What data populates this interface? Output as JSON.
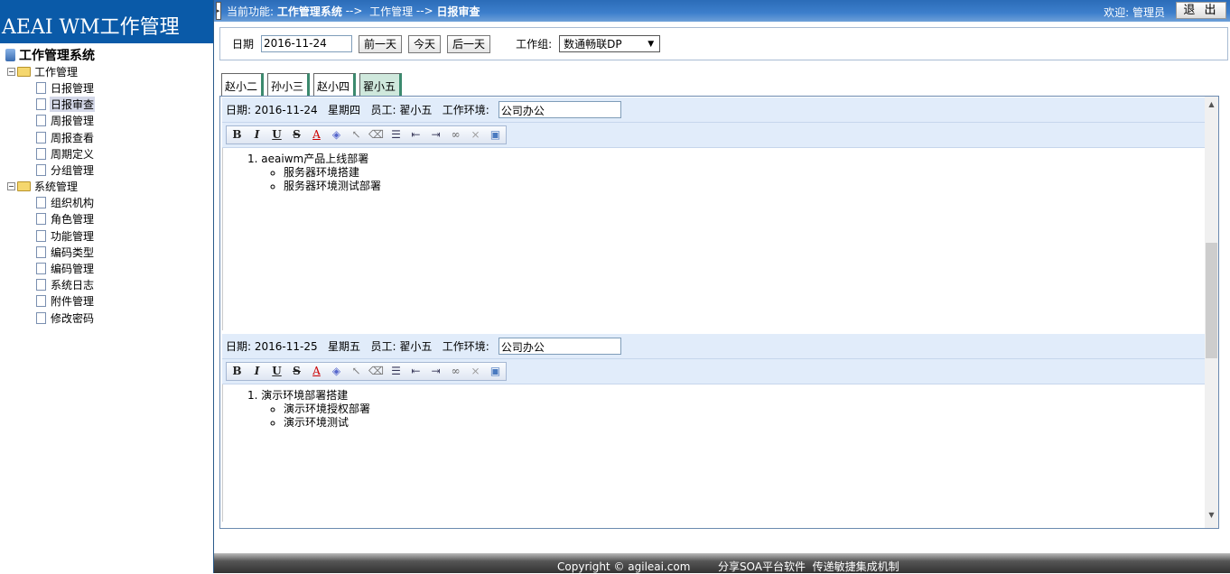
{
  "app": {
    "logo": "AEAI WM工作管理"
  },
  "tree": {
    "root": "工作管理系统",
    "groups": [
      {
        "label": "工作管理",
        "items": [
          "日报管理",
          "日报审查",
          "周报管理",
          "周报查看",
          "周期定义",
          "分组管理"
        ]
      },
      {
        "label": "系统管理",
        "items": [
          "组织机构",
          "角色管理",
          "功能管理",
          "编码类型",
          "编码管理",
          "系统日志",
          "附件管理",
          "修改密码"
        ]
      }
    ],
    "selected": "日报审查"
  },
  "topbar": {
    "prefix": "当前功能:",
    "crumb1": "工作管理系统",
    "sep": "-->",
    "crumb2": "工作管理",
    "crumb3": "日报审查",
    "welcome": "欢迎: 管理员",
    "logout": "退 出"
  },
  "filter": {
    "date_label": "日期",
    "date_value": "2016-11-24",
    "prev": "前一天",
    "today": "今天",
    "next": "后一天",
    "group_label": "工作组:",
    "group_value": "数通畅联DP"
  },
  "tabs": [
    "赵小二",
    "孙小三",
    "赵小四",
    "翟小五"
  ],
  "reports": [
    {
      "header": "日期: 2016-11-24   星期四   员工: 翟小五   工作环境:",
      "env": "公司办公",
      "item": "aeaiwm产品上线部署",
      "subs": [
        "服务器环境搭建",
        "服务器环境测试部署"
      ]
    },
    {
      "header": "日期: 2016-11-25   星期五   员工: 翟小五   工作环境:",
      "env": "公司办公",
      "item": "演示环境部署搭建",
      "subs": [
        "演示环境授权部署",
        "演示环境测试"
      ]
    }
  ],
  "toolbar": {
    "bold": "B",
    "italic": "I",
    "underline": "U",
    "strike": "S",
    "color": "A"
  },
  "footer": {
    "copyright": "Copyright © agileai.com",
    "slogan": "分享SOA平台软件  传递敏捷集成机制"
  }
}
